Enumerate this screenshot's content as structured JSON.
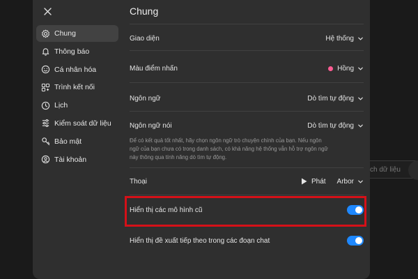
{
  "sidebar": {
    "items": [
      {
        "label": "Chung",
        "icon": "gear-icon"
      },
      {
        "label": "Thông báo",
        "icon": "bell-icon"
      },
      {
        "label": "Cá nhân hóa",
        "icon": "smile-icon"
      },
      {
        "label": "Trình kết nối",
        "icon": "connector-icon"
      },
      {
        "label": "Lịch",
        "icon": "clock-icon"
      },
      {
        "label": "Kiểm soát dữ liệu",
        "icon": "data-control-icon"
      },
      {
        "label": "Bảo mật",
        "icon": "shield-icon"
      },
      {
        "label": "Tài khoản",
        "icon": "user-icon"
      }
    ]
  },
  "main": {
    "title": "Chung",
    "settings": {
      "appearance": {
        "label": "Giao diện",
        "value": "Hệ thống"
      },
      "accent": {
        "label": "Màu điểm nhấn",
        "value": "Hồng",
        "color": "#ff5c93"
      },
      "language": {
        "label": "Ngôn ngữ",
        "value": "Dò tìm tự động"
      },
      "spoken_language": {
        "label": "Ngôn ngữ nói",
        "value": "Dò tìm tự động",
        "description": "Để có kết quả tốt nhất, hãy chọn ngôn ngữ trò chuyện chính của bạn. Nếu ngôn ngữ của bạn chưa có trong danh sách, có khả năng hệ thống vẫn hỗ trợ ngôn ngữ này thông qua tính năng dò tìm tự động."
      },
      "voice": {
        "label": "Thoại",
        "play_label": "Phát",
        "value": "Arbor"
      },
      "legacy_models": {
        "label": "Hiển thị các mô hình cũ",
        "enabled": true
      },
      "follow_up": {
        "label": "Hiển thị đề xuất tiếp theo trong các đoạn chat",
        "enabled": true
      }
    }
  },
  "background": {
    "bubble_text": "ch dữ liệu"
  },
  "colors": {
    "toggle_on": "#1e88ff",
    "highlight_border": "#d51018",
    "modal_bg": "#2f2f2f"
  }
}
